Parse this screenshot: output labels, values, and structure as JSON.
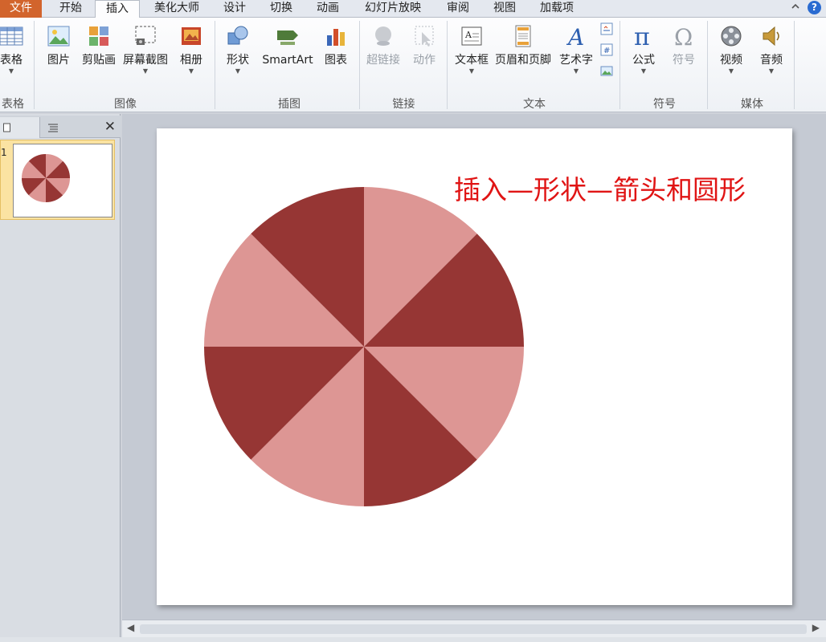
{
  "tabs": {
    "file": "文件",
    "home": "开始",
    "insert": "插入",
    "beautify": "美化大师",
    "design": "设计",
    "transitions": "切换",
    "animations": "动画",
    "slideshow": "幻灯片放映",
    "review": "审阅",
    "view": "视图",
    "addins": "加载项",
    "help_glyph": "?",
    "collapse_glyph": "^"
  },
  "ribbon": {
    "table": "表格",
    "picture": "图片",
    "clipart": "剪贴画",
    "screenshot": "屏幕截图",
    "album": "相册",
    "shapes": "形状",
    "smartart": "SmartArt",
    "chart": "图表",
    "hyperlink": "超链接",
    "action": "动作",
    "textbox": "文本框",
    "header_footer": "页眉和页脚",
    "wordart": "艺术字",
    "equation": "公式",
    "symbol": "符号",
    "video": "视频",
    "audio": "音频",
    "groups": {
      "tables": "表格",
      "images": "图像",
      "illustrations": "插图",
      "links": "链接",
      "text": "文本",
      "symbols": "符号",
      "media": "媒体"
    }
  },
  "left_panel": {
    "slide_number": "1",
    "close_glyph": "✕"
  },
  "slide": {
    "title": "插入—形状—箭头和圆形",
    "pie_colors": [
      "#dd9694",
      "#963634"
    ],
    "pie_segments": 8
  },
  "colors": {
    "accent_red": "#e01414",
    "file_tab": "#d2642c"
  }
}
